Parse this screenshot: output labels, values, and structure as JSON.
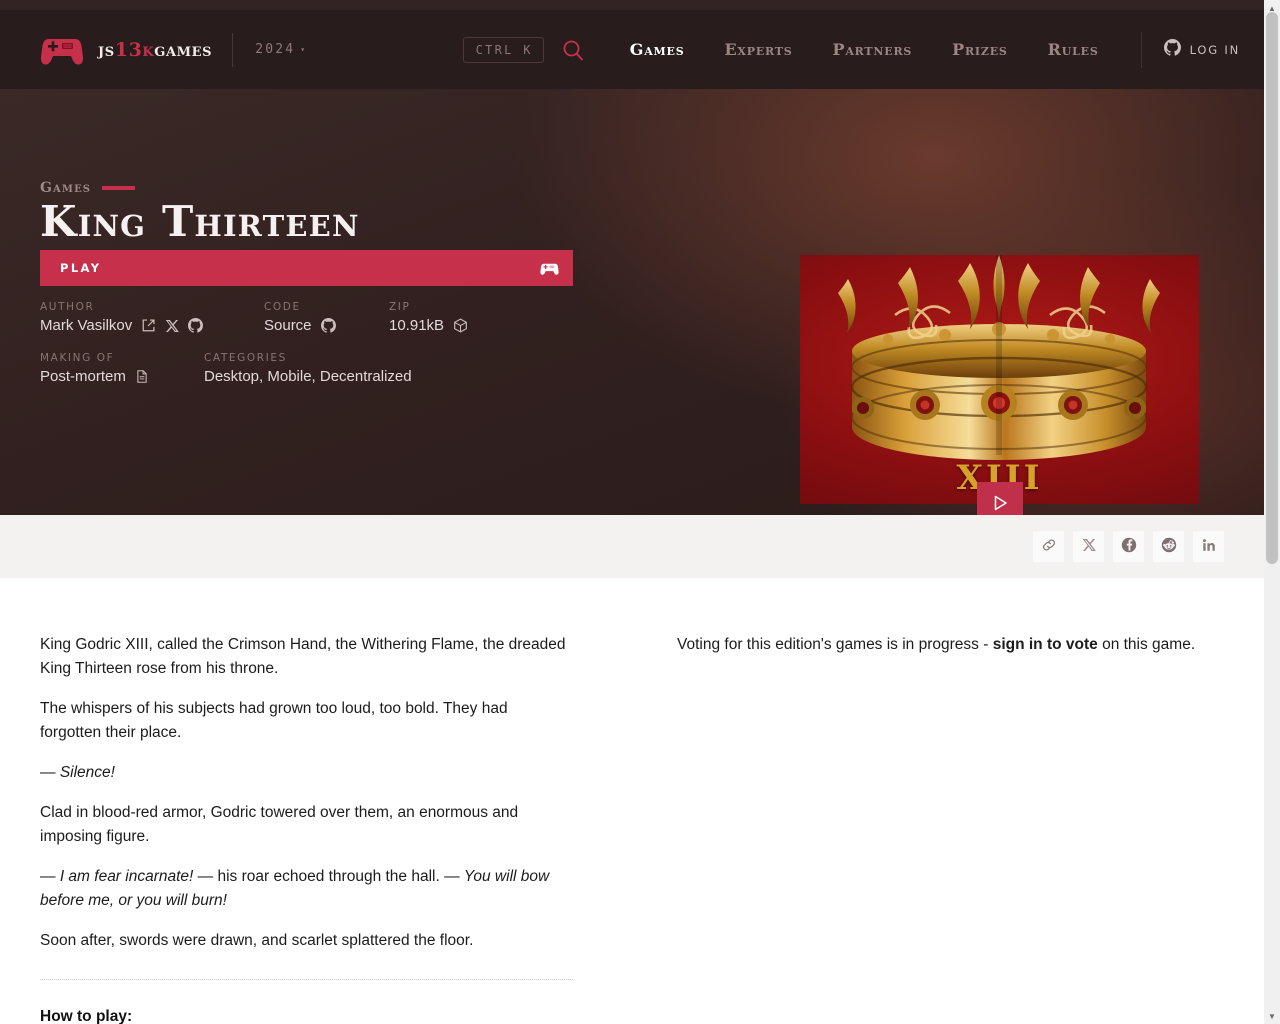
{
  "header": {
    "brand": {
      "prefix": "js",
      "accent": "13k",
      "suffix": "games"
    },
    "edition": "2024",
    "edition_caret": "▾",
    "search_hint": "CTRL K",
    "nav": [
      {
        "label": "Games",
        "active": true
      },
      {
        "label": "Experts",
        "active": false
      },
      {
        "label": "Partners",
        "active": false
      },
      {
        "label": "Prizes",
        "active": false
      },
      {
        "label": "Rules",
        "active": false
      }
    ],
    "login_label": "Log in",
    "icons": {
      "logo": "gamepad-icon",
      "search": "search-icon",
      "login": "github-icon",
      "edition": "chevron-down-icon"
    }
  },
  "hero": {
    "eyebrow": "Games",
    "title": "King Thirteen",
    "play_label": "PLAY",
    "play_icon": "gamepad-icon",
    "media_play_icon": "play-triangle-icon",
    "image_numeral": "XIII",
    "image_alt": "golden-crown-artwork",
    "meta": {
      "author": {
        "label": "Author",
        "value": "Mark Vasilkov",
        "icons": [
          "external-link-icon",
          "x-twitter-icon",
          "github-icon"
        ]
      },
      "code": {
        "label": "Code",
        "value": "Source",
        "icons": [
          "github-icon"
        ]
      },
      "zip": {
        "label": "Zip",
        "value": "10.91kB",
        "icons": [
          "package-box-icon"
        ]
      },
      "making_of": {
        "label": "Making of",
        "value": "Post-mortem",
        "icons": [
          "document-icon"
        ]
      },
      "categories": {
        "label": "Categories",
        "value": "Desktop, Mobile, Decentralized",
        "icons": []
      }
    }
  },
  "share": {
    "buttons": [
      {
        "name": "copy-link",
        "icon": "link-icon"
      },
      {
        "name": "share-x",
        "icon": "x-twitter-icon"
      },
      {
        "name": "share-facebook",
        "icon": "facebook-icon"
      },
      {
        "name": "share-reddit",
        "icon": "reddit-icon"
      },
      {
        "name": "share-linkedin",
        "icon": "linkedin-icon"
      }
    ]
  },
  "content": {
    "description": [
      "King Godric XIII, called the Crimson Hand, the Withering Flame, the dreaded King Thirteen rose from his throne.",
      "The whispers of his subjects had grown too loud, too bold. They had forgotten their place."
    ],
    "quote_silence_dash": "— ",
    "quote_silence": "Silence!",
    "paragraph_clad": "Clad in blood-red armor, Godric towered over them, an enormous and imposing figure.",
    "quote_fear_dash": "— ",
    "quote_fear_a": "I am fear incarnate!",
    "quote_fear_mid": " — his roar echoed through the hall. — ",
    "quote_fear_b": "You will bow before me, or you will burn!",
    "paragraph_soon": "Soon after, swords were drawn, and scarlet splattered the floor.",
    "how_to_play": "How to play:",
    "voting": {
      "prefix": "Voting for this edition's games is in progress - ",
      "link": "sign in to vote",
      "suffix": " on this game."
    }
  },
  "colors": {
    "accent_red": "#c7304a",
    "header_bg": "#281d1c",
    "hero_bg": "#31201f",
    "share_bg": "#f4f2f1"
  }
}
